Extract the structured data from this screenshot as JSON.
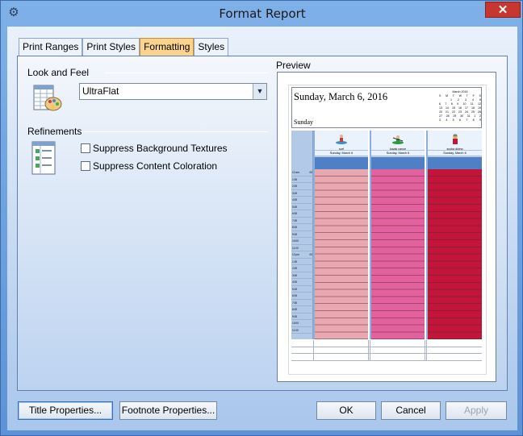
{
  "window": {
    "title": "Format Report",
    "close_glyph": "✕",
    "app_icon": "gear-icon"
  },
  "tabs": [
    {
      "label": "Print Ranges"
    },
    {
      "label": "Print Styles"
    },
    {
      "label": "Formatting",
      "active": true
    },
    {
      "label": "Styles"
    }
  ],
  "look_and_feel": {
    "label": "Look and Feel",
    "selected": "UltraFlat"
  },
  "refinements": {
    "label": "Refinements",
    "options": [
      {
        "label": "Suppress Background Textures",
        "checked": false
      },
      {
        "label": "Suppress Content Coloration",
        "checked": false
      }
    ]
  },
  "preview": {
    "label": "Preview",
    "date_title": "Sunday, March 6, 2016",
    "day_label": "Sunday",
    "mini_calendar": {
      "title": "March 2016",
      "weekdays": [
        "S",
        "M",
        "T",
        "W",
        "T",
        "F",
        "S"
      ],
      "rows": [
        [
          "",
          "",
          "1",
          "2",
          "3",
          "4",
          "5"
        ],
        [
          "6",
          "7",
          "8",
          "9",
          "10",
          "11",
          "12"
        ],
        [
          "13",
          "14",
          "15",
          "16",
          "17",
          "18",
          "19"
        ],
        [
          "20",
          "21",
          "22",
          "23",
          "24",
          "25",
          "26"
        ],
        [
          "27",
          "28",
          "29",
          "30",
          "31",
          "1",
          "2"
        ],
        [
          "3",
          "4",
          "5",
          "6",
          "7",
          "8",
          "9"
        ]
      ]
    },
    "time_slots": [
      [
        "12 am",
        "00"
      ],
      [
        "1:00",
        ""
      ],
      [
        "2:00",
        ""
      ],
      [
        "3:00",
        ""
      ],
      [
        "4:00",
        ""
      ],
      [
        "5:00",
        ""
      ],
      [
        "6:00",
        ""
      ],
      [
        "7:00",
        ""
      ],
      [
        "8:00",
        ""
      ],
      [
        "9:00",
        ""
      ],
      [
        "10:00",
        ""
      ],
      [
        "11:00",
        ""
      ],
      [
        "12 pm",
        "00"
      ],
      [
        "1:00",
        ""
      ],
      [
        "2:00",
        ""
      ],
      [
        "3:00",
        ""
      ],
      [
        "4:00",
        ""
      ],
      [
        "5:00",
        ""
      ],
      [
        "6:00",
        ""
      ],
      [
        "7:00",
        ""
      ],
      [
        "8:00",
        ""
      ],
      [
        "9:00",
        ""
      ],
      [
        "10:00",
        ""
      ],
      [
        "11:00",
        ""
      ]
    ],
    "resources": [
      {
        "name": "surf",
        "date": "Sunday, March 6",
        "color": "#e8a7b1",
        "icon": "surfer-icon"
      },
      {
        "name": "kayak canoe",
        "date": "Sunday, March 6",
        "color": "#e4619f",
        "icon": "kayak-icon"
      },
      {
        "name": "scuba diving",
        "date": "Sunday, March 6",
        "color": "#c3153a",
        "icon": "diver-icon"
      }
    ]
  },
  "buttons": {
    "title_properties": "Title Properties...",
    "footnote_properties": "Footnote Properties...",
    "ok": "OK",
    "cancel": "Cancel",
    "apply": "Apply"
  }
}
